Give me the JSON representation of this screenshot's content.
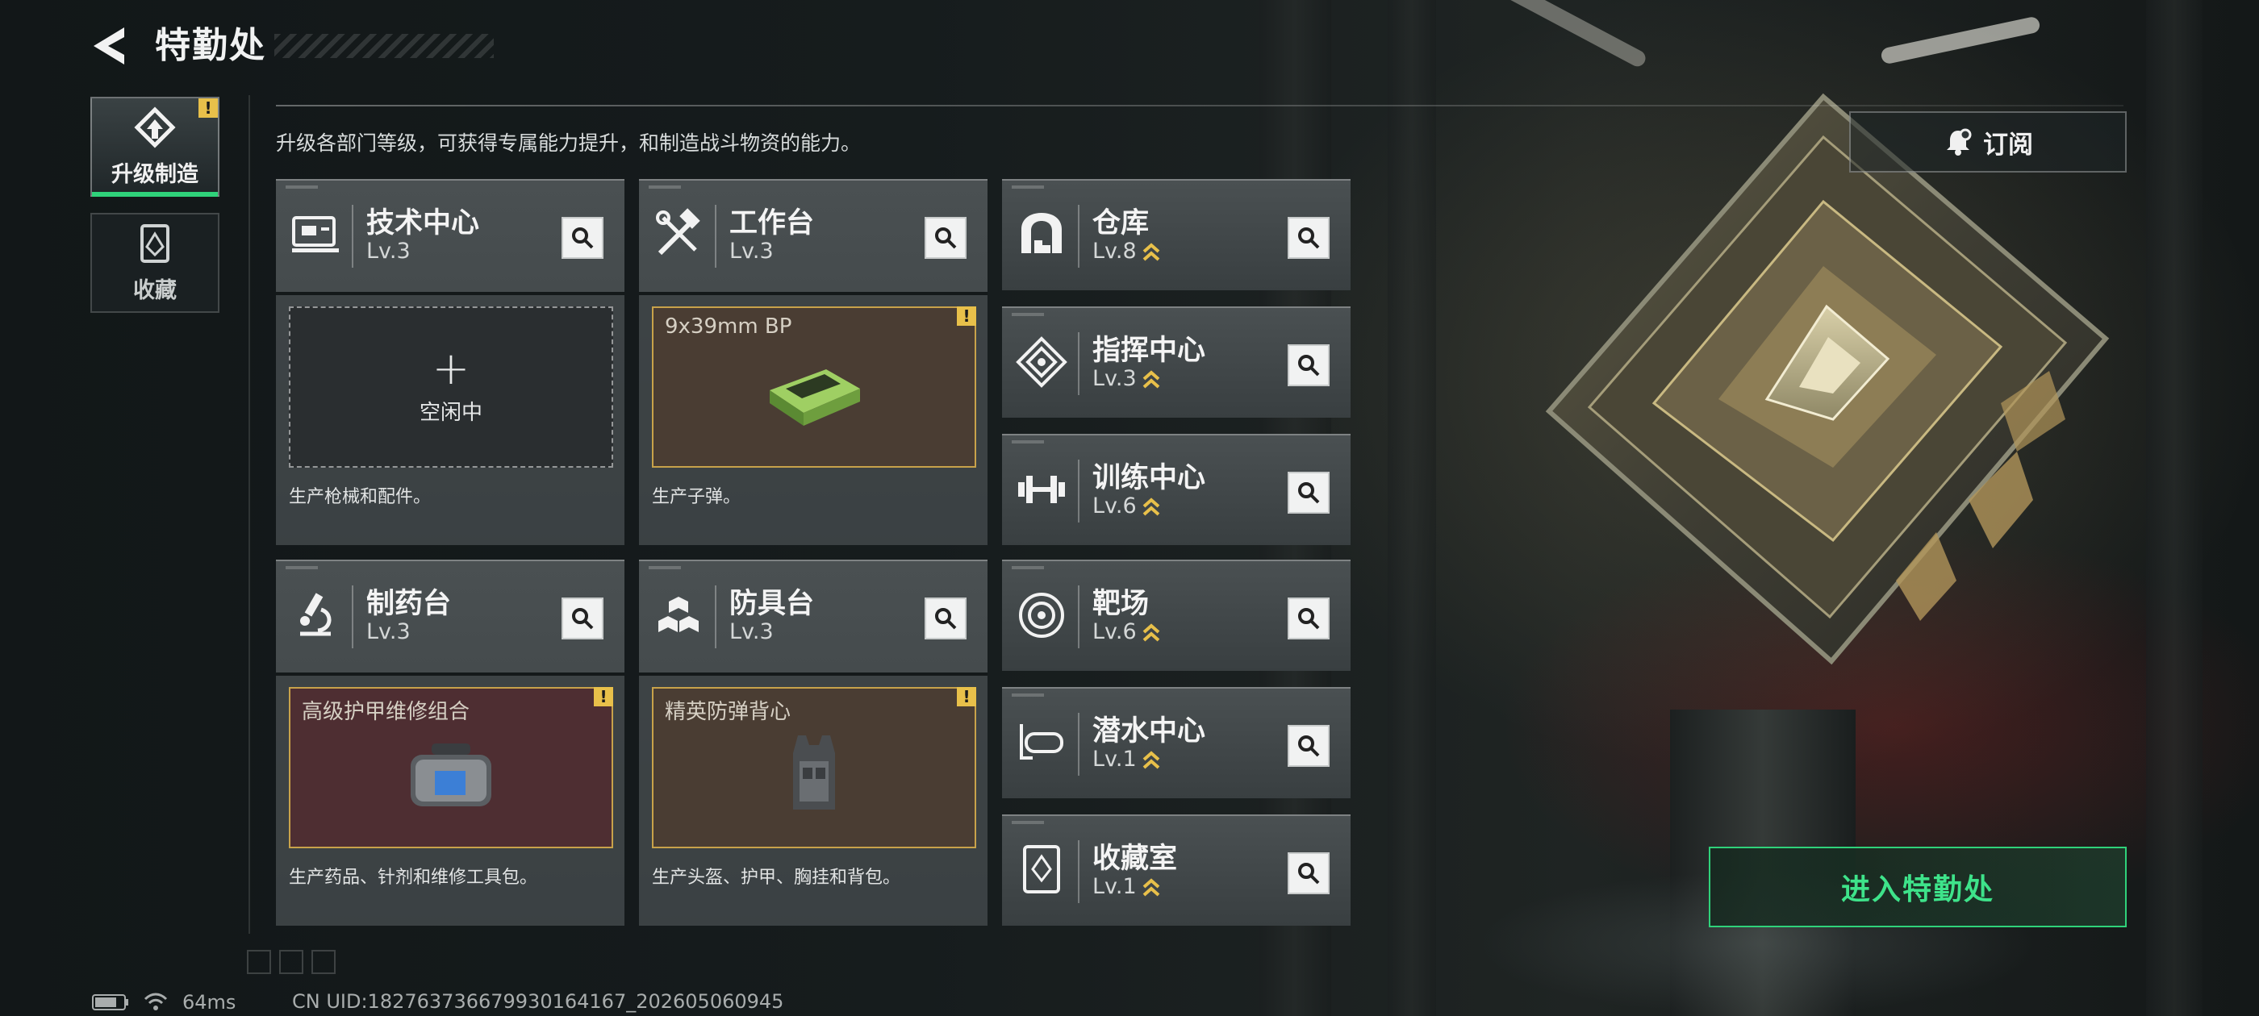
{
  "header": {
    "title": "特勤处"
  },
  "nav": {
    "tabs": [
      {
        "label": "升级制造",
        "active": true,
        "icon": "upgrade-icon",
        "warning": "!"
      },
      {
        "label": "收藏",
        "active": false,
        "icon": "collection-icon"
      }
    ]
  },
  "subtitle": "升级各部门等级，可获得专属能力提升，和制造战斗物资的能力。",
  "subscribe": {
    "label": "订阅",
    "icon": "bell-icon"
  },
  "departments": [
    {
      "name": "技术中心",
      "level": "Lv.3",
      "icon": "tech-center-icon",
      "upgradable": false,
      "slot": {
        "state": "idle",
        "label": "空闲中",
        "plus": "+"
      },
      "desc": "生产枪械和配件。"
    },
    {
      "name": "工作台",
      "level": "Lv.3",
      "icon": "workbench-icon",
      "upgradable": false,
      "slot": {
        "state": "item",
        "item_name": "9x39mm BP",
        "warning": "!"
      },
      "desc": "生产子弹。"
    },
    {
      "name": "制药台",
      "level": "Lv.3",
      "icon": "pharmacy-icon",
      "upgradable": false,
      "slot": {
        "state": "item",
        "item_name": "高级护甲维修组合",
        "warning": "!"
      },
      "desc": "生产药品、针剂和维修工具包。"
    },
    {
      "name": "防具台",
      "level": "Lv.3",
      "icon": "armor-bench-icon",
      "upgradable": false,
      "slot": {
        "state": "item",
        "item_name": "精英防弹背心",
        "warning": "!"
      },
      "desc": "生产头盔、护甲、胸挂和背包。"
    },
    {
      "name": "仓库",
      "level": "Lv.8",
      "icon": "warehouse-icon",
      "upgradable": true
    },
    {
      "name": "指挥中心",
      "level": "Lv.3",
      "icon": "command-center-icon",
      "upgradable": true
    },
    {
      "name": "训练中心",
      "level": "Lv.6",
      "icon": "training-center-icon",
      "upgradable": true
    },
    {
      "name": "靶场",
      "level": "Lv.6",
      "icon": "shooting-range-icon",
      "upgradable": true
    },
    {
      "name": "潜水中心",
      "level": "Lv.1",
      "icon": "diving-center-icon",
      "upgradable": true
    },
    {
      "name": "收藏室",
      "level": "Lv.1",
      "icon": "collection-room-icon",
      "upgradable": true
    }
  ],
  "enter_button": {
    "label": "进入特勤处"
  },
  "status": {
    "ping": "64ms",
    "uid": "CN UID:1827637366799301641​67_202605060945"
  },
  "colors": {
    "accent_green": "#2fd27a",
    "warning_yellow": "#e8c04a",
    "upgrade_arrow": "#e8c04a"
  }
}
